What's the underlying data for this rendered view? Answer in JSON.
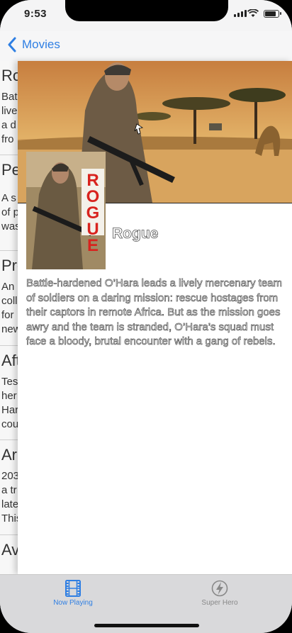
{
  "status_bar": {
    "time": "9:53"
  },
  "nav": {
    "back_label": "Movies"
  },
  "background_list": [
    {
      "title": "Ro",
      "lines": [
        "Bat",
        "live",
        "a d",
        "fro"
      ]
    },
    {
      "title": "Pe",
      "lines": [
        "A s",
        "of p",
        "was"
      ]
    },
    {
      "title": "Pro",
      "lines": [
        "An",
        "coll",
        "for",
        "new"
      ]
    },
    {
      "title": "Aft",
      "lines": [
        "Tes",
        "her",
        "Har",
        "cou"
      ]
    },
    {
      "title": "Ar",
      "lines": [
        "203",
        "a tr",
        "late",
        "This"
      ]
    },
    {
      "title": "Av",
      "lines": []
    }
  ],
  "detail": {
    "title": "Rogue",
    "poster_text": "ROGUE",
    "overview": "Battle-hardened O’Hara leads a lively mercenary team of soldiers on a daring mission: rescue hostages from their captors in remote Africa. But as the mission goes awry and the team is stranded, O’Hara’s squad must face a bloody, brutal encounter with a gang of rebels."
  },
  "tabs": [
    {
      "label": "Now Playing",
      "icon": "film-icon",
      "active": true
    },
    {
      "label": "Super Hero",
      "icon": "lightning-icon",
      "active": false
    }
  ],
  "colors": {
    "accent": "#2f7fe3",
    "poster_red": "#d8231e",
    "sky": "#d4a05a"
  }
}
